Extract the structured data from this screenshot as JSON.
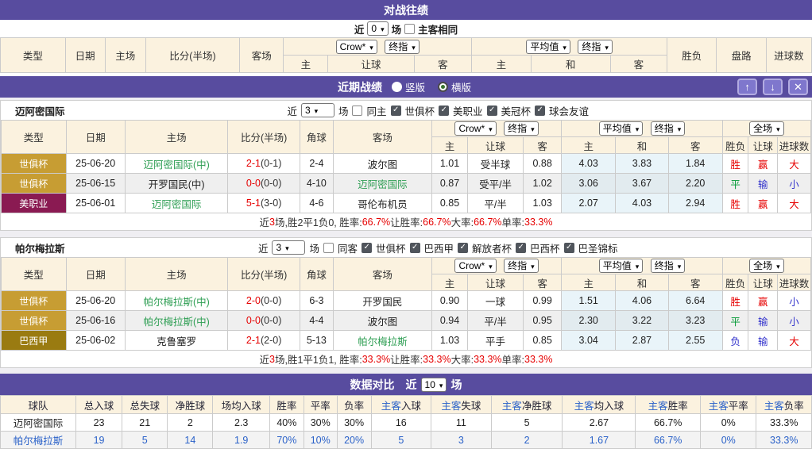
{
  "icons": {
    "up": "↑",
    "down": "↓",
    "close": "✕"
  },
  "h2h": {
    "title": "对战往绩",
    "near": "近",
    "near_value": "0",
    "games": "场",
    "same_venue": "主客相同",
    "cols": {
      "type": "类型",
      "date": "日期",
      "home": "主场",
      "score": "比分(半场)",
      "away": "客场",
      "crow": "Crow*",
      "final": "终指",
      "avg": "平均值",
      "host": "主",
      "handicap": "让球",
      "guest": "客",
      "draw": "和",
      "result": "胜负",
      "trend": "盘路",
      "goals": "进球数"
    }
  },
  "recent": {
    "title": "近期战绩",
    "radio_vertical": "竖版",
    "radio_horizontal": "横版",
    "near": "近",
    "games": "场",
    "cols": {
      "type": "类型",
      "date": "日期",
      "home": "主场",
      "score": "比分(半场)",
      "corner": "角球",
      "away": "客场",
      "crow": "Crow*",
      "final": "终指",
      "avg": "平均值",
      "full": "全场",
      "host": "主",
      "handicap": "让球",
      "guest": "客",
      "draw": "和",
      "result": "胜负",
      "handicap2": "让球",
      "goals": "进球数"
    },
    "teams": [
      {
        "name": "迈阿密国际",
        "filter": {
          "near": "3",
          "same": "同主",
          "leagues": [
            "世俱杯",
            "美职业",
            "美冠杯",
            "球会友谊"
          ]
        },
        "rows": [
          {
            "type": "世俱杯",
            "type_bg": "#C79D33",
            "date": "25-06-20",
            "home": "迈阿密国际(中)",
            "home_cls": "green",
            "score": "2-1",
            "half": "(0-1)",
            "corner": "2-4",
            "away": "波尔图",
            "away_cls": "",
            "o1": "1.01",
            "hcap": "受半球",
            "o2": "0.88",
            "a1": "4.03",
            "a2": "3.83",
            "a3": "1.84",
            "res": "胜",
            "res_c": "r",
            "trd": "赢",
            "trd_c": "r",
            "big": "大",
            "big_c": "r"
          },
          {
            "type": "世俱杯",
            "type_bg": "#C79D33",
            "date": "25-06-15",
            "home": "开罗国民(中)",
            "home_cls": "",
            "score": "0-0",
            "half": "(0-0)",
            "corner": "4-10",
            "away": "迈阿密国际",
            "away_cls": "green",
            "o1": "0.87",
            "hcap": "受平/半",
            "o2": "1.02",
            "a1": "3.06",
            "a2": "3.67",
            "a3": "2.20",
            "res": "平",
            "res_c": "g",
            "trd": "输",
            "trd_c": "b",
            "big": "小",
            "big_c": "b"
          },
          {
            "type": "美职业",
            "type_bg": "#8A1A52",
            "date": "25-06-01",
            "home": "迈阿密国际",
            "home_cls": "green",
            "score": "5-1",
            "half": "(3-0)",
            "corner": "4-6",
            "away": "哥伦布机员",
            "away_cls": "",
            "o1": "0.85",
            "hcap": "平/半",
            "o2": "1.03",
            "a1": "2.07",
            "a2": "4.03",
            "a3": "2.94",
            "res": "胜",
            "res_c": "r",
            "trd": "赢",
            "trd_c": "r",
            "big": "大",
            "big_c": "r"
          }
        ],
        "summary": [
          [
            "近",
            0
          ],
          [
            "3",
            1
          ],
          [
            "场,胜2平1负0, 胜率:",
            0
          ],
          [
            "66.7%",
            1
          ],
          [
            " 让胜率:",
            0
          ],
          [
            "66.7%",
            1
          ],
          [
            " 大率:",
            0
          ],
          [
            "66.7%",
            1
          ],
          [
            " 单率:",
            0
          ],
          [
            "33.3%",
            1
          ]
        ]
      },
      {
        "name": "帕尔梅拉斯",
        "filter": {
          "near": "3",
          "same": "同客",
          "leagues": [
            "世俱杯",
            "巴西甲",
            "解放者杯",
            "巴西杯",
            "巴圣锦标"
          ]
        },
        "rows": [
          {
            "type": "世俱杯",
            "type_bg": "#C79D33",
            "date": "25-06-20",
            "home": "帕尔梅拉斯(中)",
            "home_cls": "green",
            "score": "2-0",
            "half": "(0-0)",
            "corner": "6-3",
            "away": "开罗国民",
            "away_cls": "",
            "o1": "0.90",
            "hcap": "一球",
            "o2": "0.99",
            "a1": "1.51",
            "a2": "4.06",
            "a3": "6.64",
            "res": "胜",
            "res_c": "r",
            "trd": "赢",
            "trd_c": "r",
            "big": "小",
            "big_c": "b"
          },
          {
            "type": "世俱杯",
            "type_bg": "#C79D33",
            "date": "25-06-16",
            "home": "帕尔梅拉斯(中)",
            "home_cls": "green",
            "score": "0-0",
            "half": "(0-0)",
            "corner": "4-4",
            "away": "波尔图",
            "away_cls": "",
            "o1": "0.94",
            "hcap": "平/半",
            "o2": "0.95",
            "a1": "2.30",
            "a2": "3.22",
            "a3": "3.23",
            "res": "平",
            "res_c": "g",
            "trd": "输",
            "trd_c": "b",
            "big": "小",
            "big_c": "b"
          },
          {
            "type": "巴西甲",
            "type_bg": "#9A7B11",
            "date": "25-06-02",
            "home": "克鲁塞罗",
            "home_cls": "",
            "score": "2-1",
            "half": "(2-0)",
            "corner": "5-13",
            "away": "帕尔梅拉斯",
            "away_cls": "green",
            "o1": "1.03",
            "hcap": "平手",
            "o2": "0.85",
            "a1": "3.04",
            "a2": "2.87",
            "a3": "2.55",
            "res": "负",
            "res_c": "b",
            "trd": "输",
            "trd_c": "b",
            "big": "大",
            "big_c": "r"
          }
        ],
        "summary": [
          [
            "近",
            0
          ],
          [
            "3",
            1
          ],
          [
            "场,胜1平1负1, 胜率:",
            0
          ],
          [
            "33.3%",
            1
          ],
          [
            " 让胜率:",
            0
          ],
          [
            "33.3%",
            1
          ],
          [
            " 大率:",
            0
          ],
          [
            "33.3%",
            1
          ],
          [
            " 单率:",
            0
          ],
          [
            "33.3%",
            1
          ]
        ]
      }
    ]
  },
  "compare": {
    "title": "数据对比",
    "near": "近",
    "near_value": "10",
    "games": "场",
    "headers": [
      {
        "p": "",
        "t": "球队"
      },
      {
        "p": "",
        "t": "总入球"
      },
      {
        "p": "",
        "t": "总失球"
      },
      {
        "p": "",
        "t": "净胜球"
      },
      {
        "p": "",
        "t": "场均入球"
      },
      {
        "p": "",
        "t": "胜率"
      },
      {
        "p": "",
        "t": "平率"
      },
      {
        "p": "",
        "t": "负率"
      },
      {
        "p": "主客",
        "t": "入球"
      },
      {
        "p": "主客",
        "t": "失球"
      },
      {
        "p": "主客",
        "t": "净胜球"
      },
      {
        "p": "主客",
        "t": "均入球"
      },
      {
        "p": "主客",
        "t": "胜率"
      },
      {
        "p": "主客",
        "t": "平率"
      },
      {
        "p": "主客",
        "t": "负率"
      }
    ],
    "rows": [
      {
        "style": "dark",
        "cells": [
          "迈阿密国际",
          "23",
          "21",
          "2",
          "2.3",
          "40%",
          "30%",
          "30%",
          "16",
          "11",
          "5",
          "2.67",
          "66.7%",
          "0%",
          "33.3%"
        ]
      },
      {
        "style": "blue",
        "cells": [
          "帕尔梅拉斯",
          "19",
          "5",
          "14",
          "1.9",
          "70%",
          "10%",
          "20%",
          "5",
          "3",
          "2",
          "1.67",
          "66.7%",
          "0%",
          "33.3%"
        ]
      }
    ]
  }
}
